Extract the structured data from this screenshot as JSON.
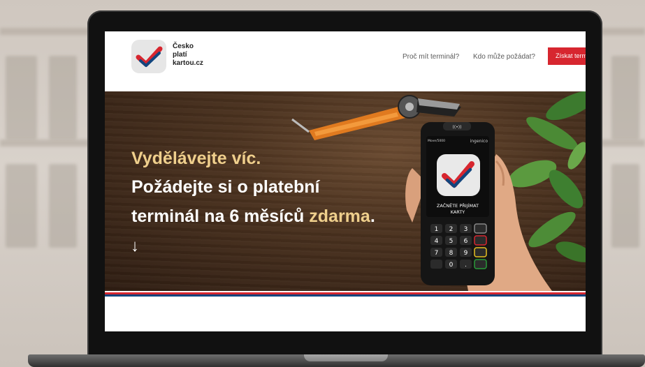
{
  "site": {
    "logo_lines": [
      "Česko",
      "platí",
      "kartou.cz"
    ],
    "nav": [
      {
        "label": "Proč mít terminál?"
      },
      {
        "label": "Kdo může požádat?"
      }
    ],
    "cta_label": "Získat term"
  },
  "hero": {
    "line1": "Vydělávejte víc.",
    "line2": "Požádejte si o platební",
    "line3_prefix": "terminál na 6 měsíců ",
    "line3_accent": "zdarma",
    "line3_suffix": ".",
    "arrow": "↓"
  },
  "terminal": {
    "model": "Move/5000",
    "brand": "ingenico",
    "screen_text_1": "ZAČNĚTE PŘIJÍMAT",
    "screen_text_2": "KARTY",
    "keys": [
      "1",
      "2",
      "3",
      "4",
      "5",
      "6",
      "7",
      "8",
      "9",
      "0",
      "."
    ]
  },
  "colors": {
    "brand_red": "#d7262f",
    "brand_blue": "#11457e",
    "accent_gold": "#efcf8c"
  }
}
